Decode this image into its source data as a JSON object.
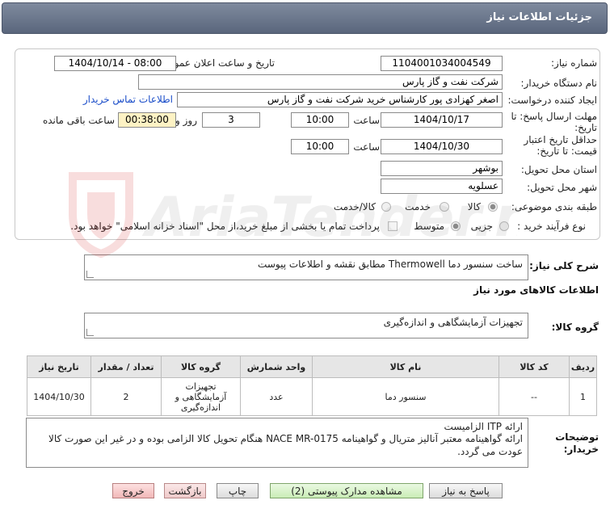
{
  "header": {
    "title": "جزئیات اطلاعات نیاز"
  },
  "form": {
    "need_number_label": "شماره نیاز:",
    "need_number": "1104001034004549",
    "announce_label": "تاریخ و ساعت اعلان عمومی:",
    "announce_value": "1404/10/14 - 08:00",
    "buyer_org_label": "نام دستگاه خریدار:",
    "buyer_org": "شرکت نفت و گاز پارس",
    "creator_label": "ایجاد کننده درخواست:",
    "creator": "اصغر کهزادی پور کارشناس خرید شرکت نفت و گاز پارس",
    "contact_link": "اطلاعات تماس خریدار",
    "reply_deadline_label_1": "مهلت ارسال پاسخ: تا",
    "reply_deadline_label_2": "تاریخ:",
    "reply_date": "1404/10/17",
    "time_label": "ساعت",
    "reply_time": "10:00",
    "days": "3",
    "days_label": "روز و",
    "remaining_time": "00:38:00",
    "remaining_label": "ساعت باقی مانده",
    "price_validity_label_1": "حداقل تاریخ اعتبار",
    "price_validity_label_2": "قیمت: تا تاریخ:",
    "validity_date": "1404/10/30",
    "validity_time": "10:00",
    "province_label": "استان محل تحویل:",
    "province": "بوشهر",
    "city_label": "شهر محل تحویل:",
    "city": "عسلویه",
    "category_label": "طبقه بندی موضوعی:",
    "category_options": [
      "کالا",
      "خدمت",
      "کالا/خدمت"
    ],
    "category_selected": "کالا",
    "process_label": "نوع فرآیند خرید :",
    "process_options": [
      "جزیی",
      "متوسط"
    ],
    "process_selected": "جزیی",
    "payment_note": "پرداخت تمام یا بخشی از مبلغ خرید،از محل \"اسناد خزانه اسلامی\" خواهد بود."
  },
  "details": {
    "summary_label": "شرح کلی نیاز:",
    "summary": "ساخت سنسور دما Thermowell مطابق نقشه و اطلاعات پیوست",
    "goods_info_title": "اطلاعات کالاهای مورد نیاز",
    "goods_group_label": "گروه کالا:",
    "goods_group": "تجهیزات آزمایشگاهی و اندازه‌گیری",
    "table": {
      "headers": [
        "ردیف",
        "کد کالا",
        "نام کالا",
        "واحد شمارش",
        "گروه کالا",
        "تعداد / مقدار",
        "تاریخ نیاز"
      ],
      "rows": [
        [
          "1",
          "--",
          "سنسور دما",
          "عدد",
          "تجهیزات آزمایشگاهی و اندازه‌گیری",
          "2",
          "1404/10/30"
        ]
      ]
    },
    "buyer_notes_label_1": "توضیحات",
    "buyer_notes_label_2": "خریدار:",
    "buyer_notes_line1": "ارائه ITP الزامیست",
    "buyer_notes_line2": "ارائه گواهینامه معتبر آنالیز متریال و گواهینامه NACE MR-0175 هنگام تحویل کالا الزامی بوده و در غیر این صورت کالا عودت می گردد."
  },
  "buttons": {
    "reply": "پاسخ به نیاز",
    "view_docs": "مشاهده مدارک پیوستی (2)",
    "print": "چاپ",
    "back": "بازگشت",
    "exit": "خروج"
  },
  "watermark": {
    "text": "AriaTender.net"
  }
}
